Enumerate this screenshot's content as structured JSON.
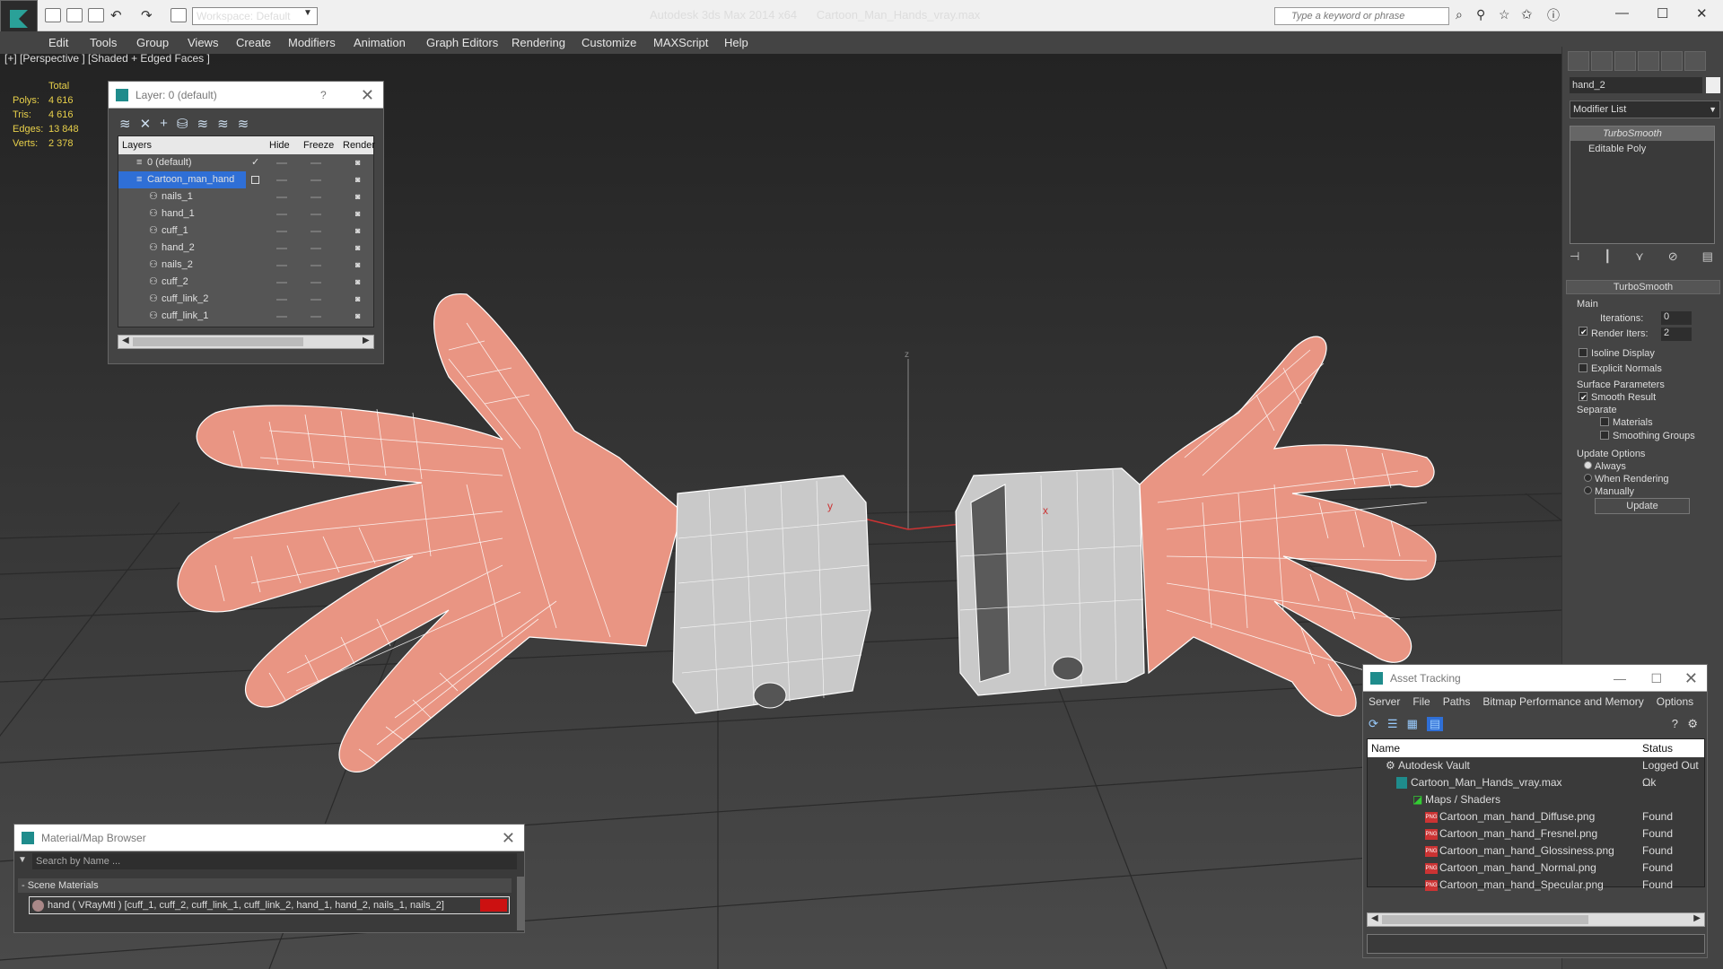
{
  "titlebar": {
    "workspace": "Workspace: Default",
    "app_title": "Autodesk 3ds Max  2014 x64",
    "file_title": "Cartoon_Man_Hands_vray.max",
    "search_placeholder": "Type a keyword or phrase"
  },
  "menu": [
    "Edit",
    "Tools",
    "Group",
    "Views",
    "Create",
    "Modifiers",
    "Animation",
    "Graph Editors",
    "Rendering",
    "Customize",
    "MAXScript",
    "Help"
  ],
  "viewport": {
    "label": "[+] [Perspective ] [Shaded + Edged Faces ]",
    "stats_header": "Total",
    "stats": [
      {
        "label": "Polys:",
        "value": "4 616"
      },
      {
        "label": "Tris:",
        "value": "4 616"
      },
      {
        "label": "Edges:",
        "value": "13 848"
      },
      {
        "label": "Verts:",
        "value": "2 378"
      }
    ],
    "axis_x": "x",
    "axis_y": "y",
    "axis_z": "z"
  },
  "layer_dialog": {
    "title": "Layer: 0 (default)",
    "help": "?",
    "columns": [
      "Layers",
      "Hide",
      "Freeze",
      "Render"
    ],
    "rows": [
      "0 (default)",
      "Cartoon_man_hand",
      "nails_1",
      "hand_1",
      "cuff_1",
      "hand_2",
      "nails_2",
      "cuff_2",
      "cuff_link_2",
      "cuff_link_1"
    ]
  },
  "material_browser": {
    "title": "Material/Map Browser",
    "search_placeholder": "Search by Name ...",
    "section": "- Scene Materials",
    "material": "hand  ( VRayMtl )  [cuff_1, cuff_2, cuff_link_1, cuff_link_2, hand_1, hand_2, nails_1, nails_2]"
  },
  "command_panel": {
    "object_name": "hand_2",
    "modifier_list": "Modifier List",
    "stack": [
      "TurboSmooth",
      "Editable Poly"
    ],
    "rollout_title": "TurboSmooth",
    "main_label": "Main",
    "iterations_label": "Iterations:",
    "iterations_value": "0",
    "render_iters_label": "Render Iters:",
    "render_iters_value": "2",
    "isoline": "Isoline Display",
    "explicit": "Explicit Normals",
    "surface_params": "Surface Parameters",
    "smooth_result": "Smooth Result",
    "separate": "Separate",
    "materials": "Materials",
    "smoothing_groups": "Smoothing Groups",
    "update_options": "Update Options",
    "always": "Always",
    "when_rendering": "When Rendering",
    "manually": "Manually",
    "update_btn": "Update"
  },
  "asset_tracking": {
    "title": "Asset Tracking",
    "menu": [
      "Server",
      "File",
      "Paths",
      "Bitmap Performance and Memory",
      "Options"
    ],
    "col_name": "Name",
    "col_status": "Status",
    "rows": [
      {
        "name": "Autodesk Vault",
        "status": "Logged Out ..."
      },
      {
        "name": "Cartoon_Man_Hands_vray.max",
        "status": "Ok"
      },
      {
        "name": "Maps / Shaders",
        "status": ""
      },
      {
        "name": "Cartoon_man_hand_Diffuse.png",
        "status": "Found"
      },
      {
        "name": "Cartoon_man_hand_Fresnel.png",
        "status": "Found"
      },
      {
        "name": "Cartoon_man_hand_Glossiness.png",
        "status": "Found"
      },
      {
        "name": "Cartoon_man_hand_Normal.png",
        "status": "Found"
      },
      {
        "name": "Cartoon_man_hand_Specular.png",
        "status": "Found"
      }
    ]
  },
  "colors": {
    "skin": "#e99583",
    "wire": "#ffffff",
    "cuff": "#c9c9c9",
    "selection": "#2f6fd6",
    "stats": "#e8d04a"
  }
}
